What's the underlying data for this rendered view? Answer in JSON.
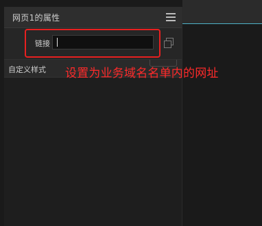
{
  "panel": {
    "title": "网页1的属性",
    "menu_icon": "hamburger-menu-icon"
  },
  "link_section": {
    "label": "链接",
    "input_value": "",
    "copy_icon": "copy-icon"
  },
  "style_section": {
    "label": "自定义样式"
  },
  "annotation": {
    "text": "设置为业务域名名单内的网址",
    "color": "#ff2a2a"
  },
  "colors": {
    "accent_line": "#4fb3c9",
    "highlight_border": "#e82020"
  }
}
